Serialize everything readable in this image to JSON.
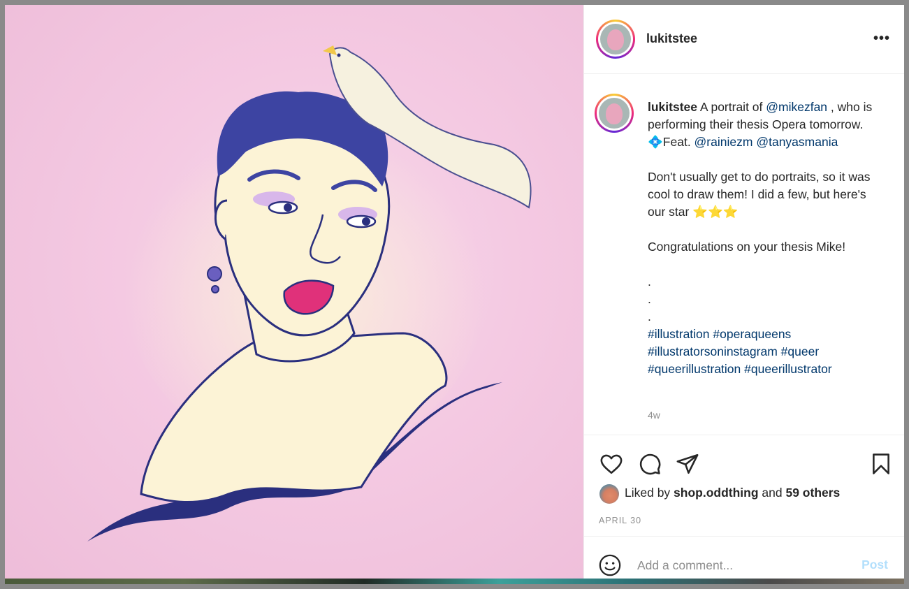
{
  "post": {
    "username": "lukitstee",
    "more_icon": "more-options-icon",
    "image_alt": "",
    "caption": {
      "username": "lukitstee",
      "line1_text": " A portrait of ",
      "mention1": "@mikezfan",
      "line1_tail": " , who is performing their thesis Opera tomorrow. ",
      "diamond_emoji": "💠",
      "feat_text": "Feat. ",
      "mention2": "@rainiezm",
      "mention3": "@tanyasmania",
      "para2": "Don't usually get to do portraits, so it was cool to draw them! I did a few, but here's our star ",
      "stars": "⭐⭐⭐",
      "para3": "Congratulations on your thesis Mike!",
      "dot1": ".",
      "dot2": ".",
      "dot3": ".",
      "hashtags": [
        "#illustration",
        "#operaqueens",
        "#illustratorsoninstagram",
        "#queer",
        "#queerillustration",
        "#queerillustrator"
      ]
    },
    "time_ago": "4w",
    "likes": {
      "prefix": "Liked by ",
      "liker": "shop.oddthing",
      "middle": " and ",
      "others": "59 others"
    },
    "date": "APRIL 30",
    "comment": {
      "placeholder": "Add a comment...",
      "post_label": "Post"
    },
    "colors": {
      "link": "#00376b",
      "text": "#262626",
      "muted": "#8e8e8e",
      "post_disabled": "#b2dffc"
    }
  }
}
